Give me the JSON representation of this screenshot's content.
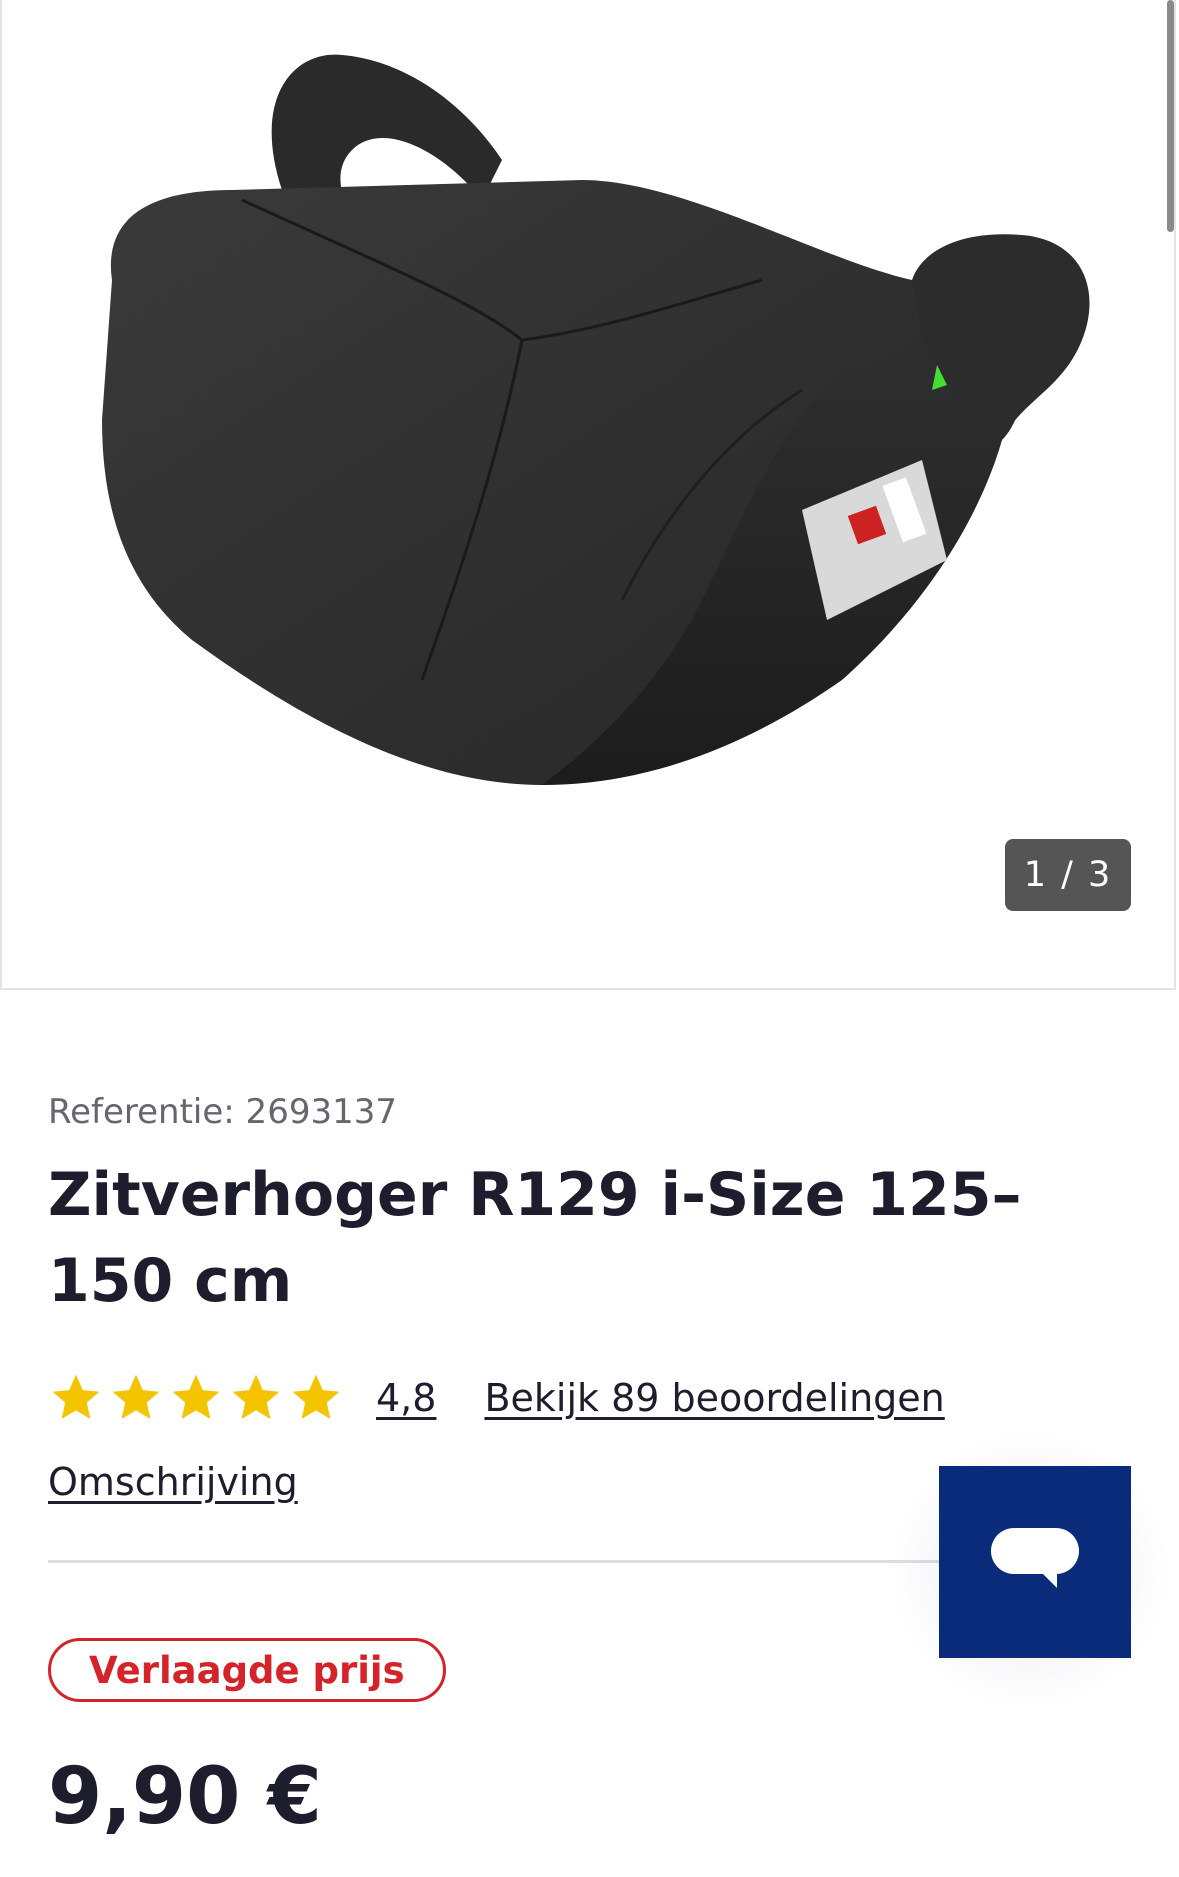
{
  "gallery": {
    "product_image": "booster-seat-image",
    "counter": "1 / 3"
  },
  "product": {
    "reference": "Referentie: 2693137",
    "title": "Zitverhoger R129 i-Size 125–150 cm",
    "rating_value": "4,8",
    "rating_stars": 5,
    "reviews_link": "Bekijk 89 beoordelingen",
    "description_link": "Omschrijving",
    "badge": "Verlaagde prijs",
    "price": "9,90 €"
  },
  "colors": {
    "star": "#f5c400",
    "badge_red": "#d6232a",
    "chat_blue": "#0a2a7a",
    "text_dark": "#1d1d2d"
  },
  "icons": {
    "chat": "chat-bubble-icon",
    "star": "star-icon"
  }
}
